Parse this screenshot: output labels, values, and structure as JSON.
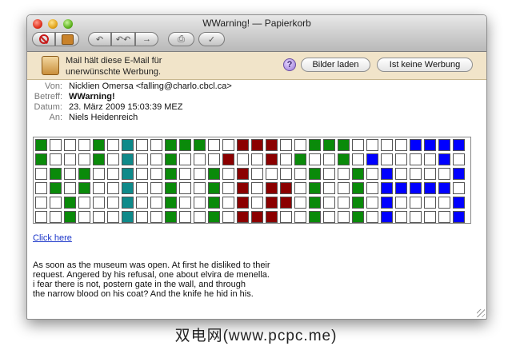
{
  "window": {
    "title": "WWarning! — Papierkorb"
  },
  "toolbar": {
    "buttons": [
      {
        "name": "delete-button",
        "icon": "stop-icon"
      },
      {
        "name": "junk-button",
        "icon": "junk-icon"
      },
      {
        "name": "reply-button",
        "icon": "reply-arrow-icon",
        "glyph": "↶"
      },
      {
        "name": "reply-all-button",
        "icon": "reply-all-arrow-icon",
        "glyph": "↶↶"
      },
      {
        "name": "forward-button",
        "icon": "forward-arrow-icon",
        "glyph": "→"
      },
      {
        "name": "print-button",
        "icon": "printer-icon",
        "glyph": "⎙"
      },
      {
        "name": "flag-button",
        "icon": "checkmark-icon",
        "glyph": "✓"
      }
    ]
  },
  "banner": {
    "text": "Mail hält diese E-Mail für unerwünschte Werbung.",
    "help_glyph": "?",
    "load_images_label": "Bilder laden",
    "not_junk_label": "Ist keine Werbung"
  },
  "headers": {
    "from_label": "Von:",
    "from_value": "Nicklien Omersa <falling@charlo.cbcl.ca>",
    "subject_label": "Betreff:",
    "subject_value": "WWarning!",
    "date_label": "Datum:",
    "date_value": "23. März 2009 15:03:39 MEZ",
    "to_label": "An:",
    "to_value": "Niels Heidenreich"
  },
  "colors": {
    "green": "#0a8a0a",
    "teal": "#0f8a8a",
    "gray": "#8a8a8a",
    "darkred": "#8b0000",
    "blue": "#0000ff",
    "white": "#ffffff"
  },
  "grid_rows": [
    "GWWWGWTWWGGGWWDDDWWGGGWWWWBBBB",
    "GWWWGWTWWGWWWDWWDWGWWGWBWWWWB",
    "WGWGWWTWWGWWGWDWWWWGWWGWBWWWWB",
    "WGWGWWTWWGWWGWDWDDWGWWGWBBBBB",
    "WWGWWWTWWGWWGWDWDDWGWWGWBWWWWB",
    "WWGWWWTWWGWWGWDDDWWGWWGWBWWWWB"
  ],
  "link": {
    "label": "Click here"
  },
  "body_lines": [
    "As soon as the museum was open. At first he disliked to their",
    "request. Angered by his refusal, one about elvira de menella.",
    "i fear there is not, postern gate in the wall, and through",
    "the narrow blood on his coat? And the knife he hid in his."
  ],
  "watermark": "双电网(www.pcpc.me)"
}
